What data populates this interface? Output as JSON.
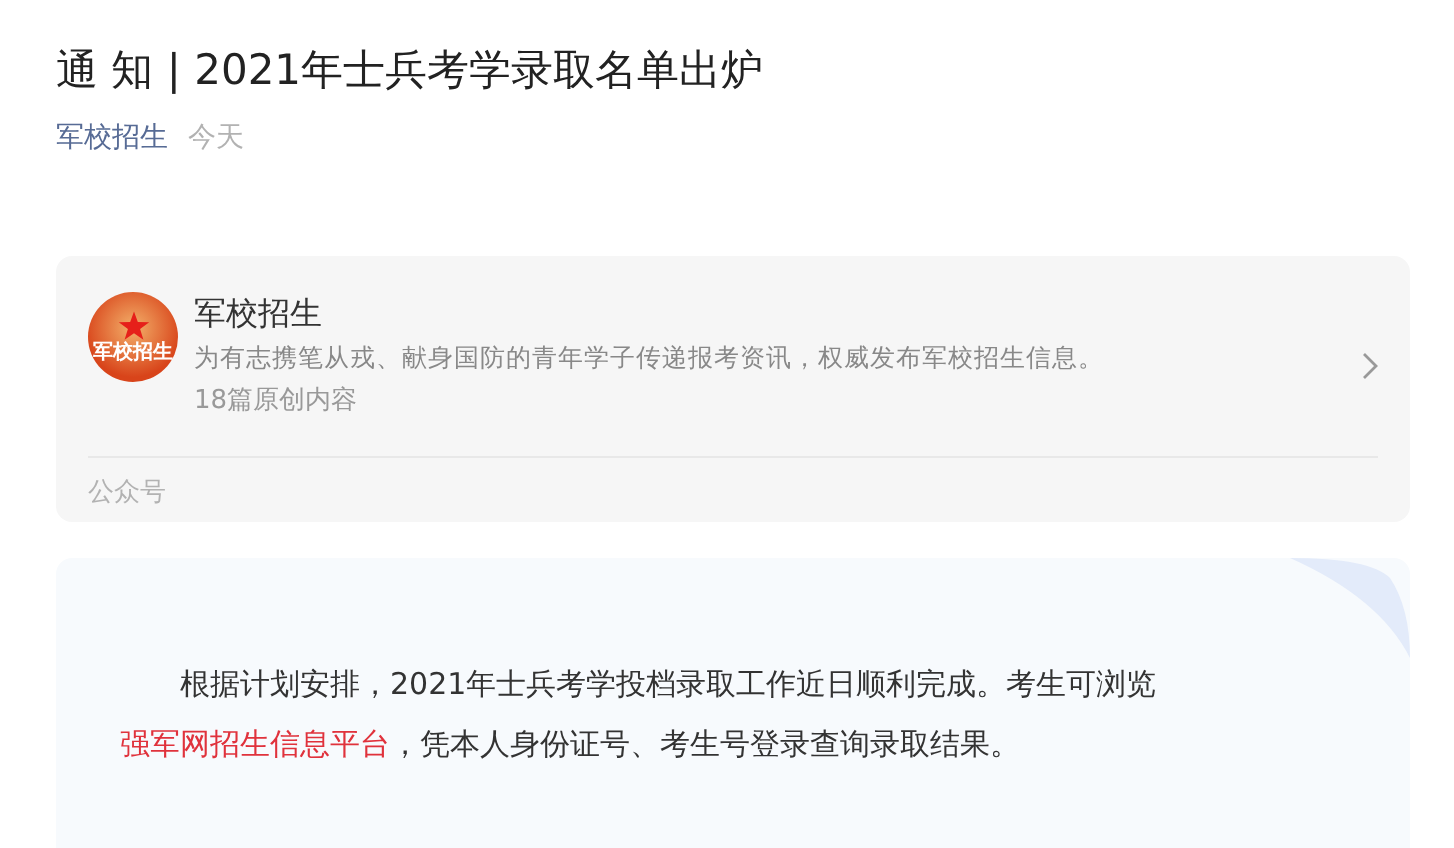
{
  "title": "通 知 | 2021年士兵考学录取名单出炉",
  "meta": {
    "author": "军校招生",
    "time": "今天"
  },
  "account_card": {
    "logo_text": "军校招生",
    "name": "军校招生",
    "description": "为有志携笔从戎、献身国防的青年学子传递报考资讯，权威发布军校招生信息。",
    "count": "18篇原创内容",
    "footer": "公众号"
  },
  "article": {
    "before": "根据计划安排，2021年士兵考学投档录取工作近日顺利完成。考生可浏览",
    "link": "强军网招生信息平台",
    "after": "，凭本人身份证号、考生号登录查询录取结果。"
  }
}
